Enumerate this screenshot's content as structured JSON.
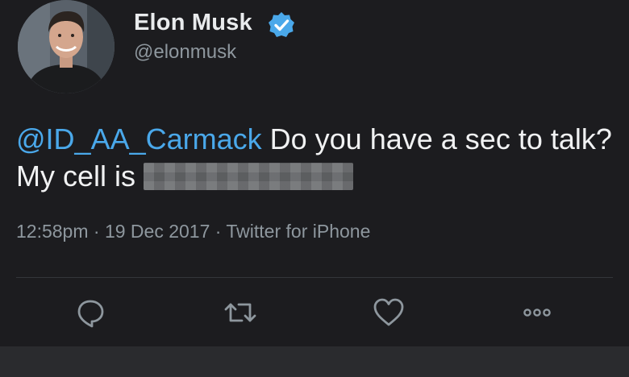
{
  "user": {
    "display_name": "Elon Musk",
    "handle": "@elonmusk",
    "verified": true,
    "avatar_icon": "profile-photo"
  },
  "tweet": {
    "mention": "@ID_AA_Carmack",
    "text": " Do you have a sec to talk? My cell is ",
    "redacted": true
  },
  "meta": {
    "time": "12:58pm",
    "date": "19 Dec 2017",
    "source": "Twitter for iPhone",
    "line": "12:58pm · 19 Dec 2017 · Twitter for iPhone"
  },
  "actions": [
    {
      "name": "reply",
      "icon": "reply-icon"
    },
    {
      "name": "retweet",
      "icon": "retweet-icon"
    },
    {
      "name": "like",
      "icon": "heart-icon"
    },
    {
      "name": "more",
      "icon": "more-icon"
    }
  ],
  "colors": {
    "background": "#1c1c1f",
    "mention": "#4aa8ea",
    "verified_badge": "#4aa8ea",
    "text": "#f1f2f3",
    "secondary_text": "#8e979e",
    "icon": "#8e979e"
  }
}
